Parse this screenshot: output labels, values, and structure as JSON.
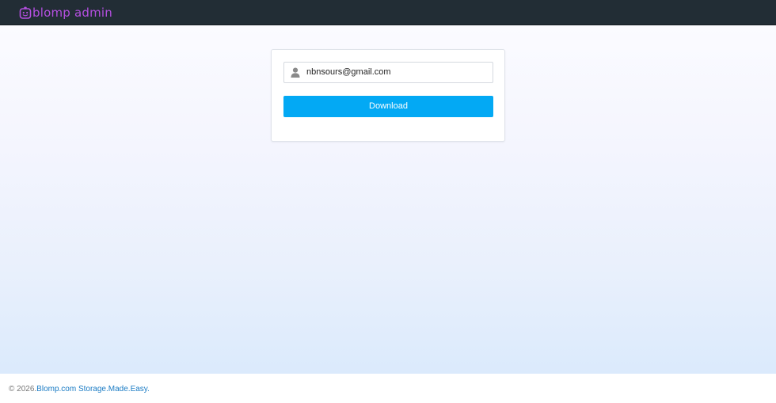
{
  "header": {
    "logo_text": "blomp admin",
    "logo_icon": "blomp-robot-icon",
    "bar_color": "#222d35",
    "brand_color": "#b44fe0"
  },
  "form": {
    "email_value": "nbnsours@gmail.com",
    "user_icon": "user-icon",
    "download_label": "Download",
    "button_color": "#03a9f4"
  },
  "footer": {
    "copyright": "© 2026.",
    "site_link": "Blomp.com",
    "tagline": "Storage.Made.Easy."
  }
}
